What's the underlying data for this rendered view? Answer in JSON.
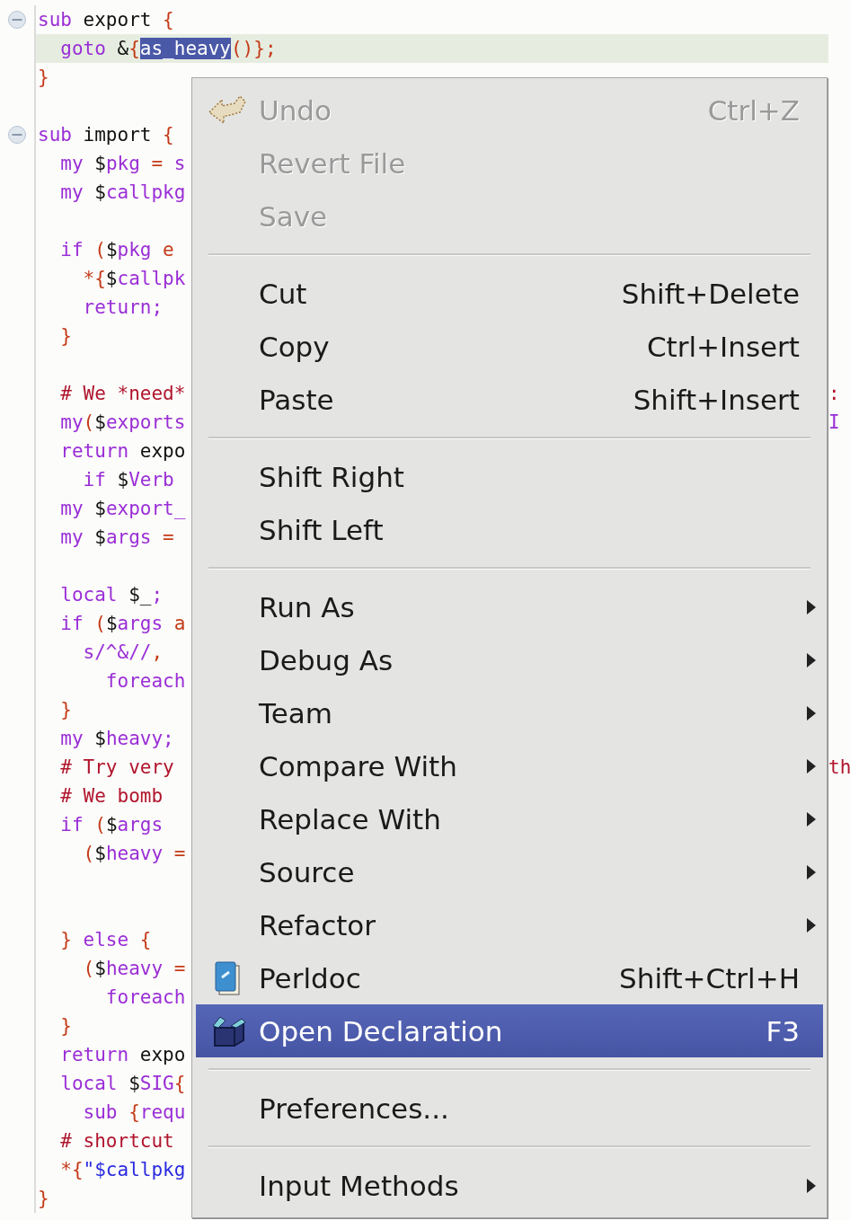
{
  "editor": {
    "lines": [
      {
        "kind": "fold-start",
        "current": false,
        "tokens": [
          {
            "kind": "kw",
            "text": "sub"
          },
          {
            "kind": "pl",
            "text": " export "
          },
          {
            "kind": "op",
            "text": "{"
          }
        ]
      },
      {
        "kind": "code",
        "current": true,
        "tokens": [
          {
            "kind": "kw",
            "text": "  goto"
          },
          {
            "kind": "pl",
            "text": " &"
          },
          {
            "kind": "op",
            "text": "{"
          },
          {
            "kind": "sel",
            "text": "as_heavy"
          },
          {
            "kind": "op",
            "text": "()};"
          }
        ]
      },
      {
        "kind": "code",
        "current": false,
        "tokens": [
          {
            "kind": "op",
            "text": "}"
          }
        ]
      },
      {
        "kind": "blank"
      },
      {
        "kind": "fold-start",
        "current": false,
        "tokens": [
          {
            "kind": "kw",
            "text": "sub"
          },
          {
            "kind": "pl",
            "text": " import "
          },
          {
            "kind": "op",
            "text": "{"
          }
        ]
      },
      {
        "kind": "code",
        "current": false,
        "tokens": [
          {
            "kind": "kw",
            "text": "  my "
          },
          {
            "kind": "sig",
            "text": "$"
          },
          {
            "kind": "kw",
            "text": "pkg"
          },
          {
            "kind": "op",
            "text": " = "
          },
          {
            "kind": "kw",
            "text": "s"
          }
        ]
      },
      {
        "kind": "code",
        "current": false,
        "tokens": [
          {
            "kind": "kw",
            "text": "  my "
          },
          {
            "kind": "sig",
            "text": "$"
          },
          {
            "kind": "kw",
            "text": "callpkg"
          }
        ]
      },
      {
        "kind": "blank"
      },
      {
        "kind": "code",
        "current": false,
        "tokens": [
          {
            "kind": "kw",
            "text": "  if "
          },
          {
            "kind": "op",
            "text": "("
          },
          {
            "kind": "sig",
            "text": "$"
          },
          {
            "kind": "kw",
            "text": "pkg"
          },
          {
            "kind": "op",
            "text": " e"
          }
        ]
      },
      {
        "kind": "code",
        "current": false,
        "tokens": [
          {
            "kind": "op",
            "text": "    *{"
          },
          {
            "kind": "sig",
            "text": "$"
          },
          {
            "kind": "kw",
            "text": "callpk"
          }
        ]
      },
      {
        "kind": "code",
        "current": false,
        "tokens": [
          {
            "kind": "kw",
            "text": "    return;"
          }
        ]
      },
      {
        "kind": "code",
        "current": false,
        "tokens": [
          {
            "kind": "op",
            "text": "  }"
          }
        ]
      },
      {
        "kind": "blank"
      },
      {
        "kind": "code",
        "current": false,
        "tokens": [
          {
            "kind": "cm",
            "text": "  # We *need*"
          }
        ],
        "right": [
          {
            "kind": "cm",
            "text": ":"
          }
        ]
      },
      {
        "kind": "code",
        "current": false,
        "tokens": [
          {
            "kind": "kw",
            "text": "  my"
          },
          {
            "kind": "op",
            "text": "("
          },
          {
            "kind": "sig",
            "text": "$"
          },
          {
            "kind": "kw",
            "text": "exports"
          }
        ],
        "right": [
          {
            "kind": "kw",
            "text": "I"
          }
        ]
      },
      {
        "kind": "code",
        "current": false,
        "tokens": [
          {
            "kind": "kw",
            "text": "  return"
          },
          {
            "kind": "pl",
            "text": " expo"
          }
        ]
      },
      {
        "kind": "code",
        "current": false,
        "tokens": [
          {
            "kind": "kw",
            "text": "    if "
          },
          {
            "kind": "sig",
            "text": "$"
          },
          {
            "kind": "kw",
            "text": "Verb"
          }
        ]
      },
      {
        "kind": "code",
        "current": false,
        "tokens": [
          {
            "kind": "kw",
            "text": "  my "
          },
          {
            "kind": "sig",
            "text": "$"
          },
          {
            "kind": "kw",
            "text": "export_"
          }
        ]
      },
      {
        "kind": "code",
        "current": false,
        "tokens": [
          {
            "kind": "kw",
            "text": "  my "
          },
          {
            "kind": "sig",
            "text": "$"
          },
          {
            "kind": "kw",
            "text": "args"
          },
          {
            "kind": "op",
            "text": " ="
          }
        ]
      },
      {
        "kind": "blank"
      },
      {
        "kind": "code",
        "current": false,
        "tokens": [
          {
            "kind": "kw",
            "text": "  local "
          },
          {
            "kind": "sig",
            "text": "$_"
          },
          {
            "kind": "kw",
            "text": ";"
          }
        ]
      },
      {
        "kind": "code",
        "current": false,
        "tokens": [
          {
            "kind": "kw",
            "text": "  if "
          },
          {
            "kind": "op",
            "text": "("
          },
          {
            "kind": "sig",
            "text": "$"
          },
          {
            "kind": "kw",
            "text": "args"
          },
          {
            "kind": "op",
            "text": " a"
          }
        ]
      },
      {
        "kind": "code",
        "current": false,
        "tokens": [
          {
            "kind": "kw",
            "text": "    s/^&//"
          },
          {
            "kind": "op",
            "text": ","
          }
        ]
      },
      {
        "kind": "code",
        "current": false,
        "tokens": [
          {
            "kind": "kw",
            "text": "      foreach"
          }
        ]
      },
      {
        "kind": "code",
        "current": false,
        "tokens": [
          {
            "kind": "op",
            "text": "  }"
          }
        ]
      },
      {
        "kind": "code",
        "current": false,
        "tokens": [
          {
            "kind": "kw",
            "text": "  my "
          },
          {
            "kind": "sig",
            "text": "$"
          },
          {
            "kind": "kw",
            "text": "heavy;"
          }
        ]
      },
      {
        "kind": "code",
        "current": false,
        "tokens": [
          {
            "kind": "cm",
            "text": "  # Try very"
          }
        ],
        "right": [
          {
            "kind": "cm",
            "text": "th"
          }
        ]
      },
      {
        "kind": "code",
        "current": false,
        "tokens": [
          {
            "kind": "cm",
            "text": "  # We bomb"
          }
        ]
      },
      {
        "kind": "code",
        "current": false,
        "tokens": [
          {
            "kind": "kw",
            "text": "  if "
          },
          {
            "kind": "op",
            "text": "("
          },
          {
            "kind": "sig",
            "text": "$"
          },
          {
            "kind": "kw",
            "text": "args"
          }
        ]
      },
      {
        "kind": "code",
        "current": false,
        "tokens": [
          {
            "kind": "op",
            "text": "    ("
          },
          {
            "kind": "sig",
            "text": "$"
          },
          {
            "kind": "kw",
            "text": "heavy"
          },
          {
            "kind": "op",
            "text": " ="
          }
        ]
      },
      {
        "kind": "blank"
      },
      {
        "kind": "blank"
      },
      {
        "kind": "code",
        "current": false,
        "tokens": [
          {
            "kind": "op",
            "text": "  } "
          },
          {
            "kind": "kw",
            "text": "else"
          },
          {
            "kind": "op",
            "text": " {"
          }
        ]
      },
      {
        "kind": "code",
        "current": false,
        "tokens": [
          {
            "kind": "op",
            "text": "    ("
          },
          {
            "kind": "sig",
            "text": "$"
          },
          {
            "kind": "kw",
            "text": "heavy"
          },
          {
            "kind": "op",
            "text": " ="
          }
        ]
      },
      {
        "kind": "code",
        "current": false,
        "tokens": [
          {
            "kind": "kw",
            "text": "      foreach"
          }
        ]
      },
      {
        "kind": "code",
        "current": false,
        "tokens": [
          {
            "kind": "op",
            "text": "  }"
          }
        ]
      },
      {
        "kind": "code",
        "current": false,
        "tokens": [
          {
            "kind": "kw",
            "text": "  return"
          },
          {
            "kind": "pl",
            "text": " expo"
          }
        ]
      },
      {
        "kind": "code",
        "current": false,
        "tokens": [
          {
            "kind": "kw",
            "text": "  local "
          },
          {
            "kind": "sig",
            "text": "$"
          },
          {
            "kind": "kw",
            "text": "SIG"
          },
          {
            "kind": "op",
            "text": "{"
          }
        ]
      },
      {
        "kind": "code",
        "current": false,
        "tokens": [
          {
            "kind": "kw",
            "text": "    sub "
          },
          {
            "kind": "op",
            "text": "{"
          },
          {
            "kind": "kw",
            "text": "requ"
          }
        ]
      },
      {
        "kind": "code",
        "current": false,
        "tokens": [
          {
            "kind": "cm",
            "text": "  # shortcut"
          }
        ]
      },
      {
        "kind": "code",
        "current": false,
        "tokens": [
          {
            "kind": "op",
            "text": "  *{"
          },
          {
            "kind": "str",
            "text": "\"$callpkg"
          }
        ]
      },
      {
        "kind": "code",
        "current": false,
        "tokens": [
          {
            "kind": "op",
            "text": "}"
          }
        ]
      }
    ]
  },
  "context_menu": {
    "items": [
      {
        "kind": "item",
        "label": "Undo",
        "shortcut": "Ctrl+Z",
        "disabled": true,
        "selected": false,
        "submenu": false
      },
      {
        "kind": "item",
        "label": "Revert File",
        "disabled": true,
        "selected": false,
        "submenu": false
      },
      {
        "kind": "item",
        "label": "Save",
        "disabled": true,
        "selected": false,
        "submenu": false
      },
      {
        "kind": "separator"
      },
      {
        "kind": "item",
        "label": "Cut",
        "shortcut": "Shift+Delete",
        "disabled": false,
        "selected": false,
        "submenu": false
      },
      {
        "kind": "item",
        "label": "Copy",
        "shortcut": "Ctrl+Insert",
        "disabled": false,
        "selected": false,
        "submenu": false
      },
      {
        "kind": "item",
        "label": "Paste",
        "shortcut": "Shift+Insert",
        "disabled": false,
        "selected": false,
        "submenu": false
      },
      {
        "kind": "separator"
      },
      {
        "kind": "item",
        "label": "Shift Right",
        "disabled": false,
        "selected": false,
        "submenu": false
      },
      {
        "kind": "item",
        "label": "Shift Left",
        "disabled": false,
        "selected": false,
        "submenu": false
      },
      {
        "kind": "separator"
      },
      {
        "kind": "item",
        "label": "Run As",
        "disabled": false,
        "selected": false,
        "submenu": true
      },
      {
        "kind": "item",
        "label": "Debug As",
        "disabled": false,
        "selected": false,
        "submenu": true
      },
      {
        "kind": "item",
        "label": "Team",
        "disabled": false,
        "selected": false,
        "submenu": true
      },
      {
        "kind": "item",
        "label": "Compare With",
        "disabled": false,
        "selected": false,
        "submenu": true
      },
      {
        "kind": "item",
        "label": "Replace With",
        "disabled": false,
        "selected": false,
        "submenu": true
      },
      {
        "kind": "item",
        "label": "Source",
        "disabled": false,
        "selected": false,
        "submenu": true
      },
      {
        "kind": "item",
        "label": "Refactor",
        "disabled": false,
        "selected": false,
        "submenu": true
      },
      {
        "kind": "item",
        "label": "Perldoc",
        "shortcut": "Shift+Ctrl+H",
        "disabled": false,
        "selected": false,
        "submenu": false
      },
      {
        "kind": "item",
        "label": "Open Declaration",
        "shortcut": "F3",
        "disabled": false,
        "selected": true,
        "submenu": false
      },
      {
        "kind": "separator"
      },
      {
        "kind": "item",
        "label": "Preferences...",
        "disabled": false,
        "selected": false,
        "submenu": false
      },
      {
        "kind": "separator"
      },
      {
        "kind": "item",
        "label": "Input Methods",
        "disabled": false,
        "selected": false,
        "submenu": true
      }
    ]
  }
}
